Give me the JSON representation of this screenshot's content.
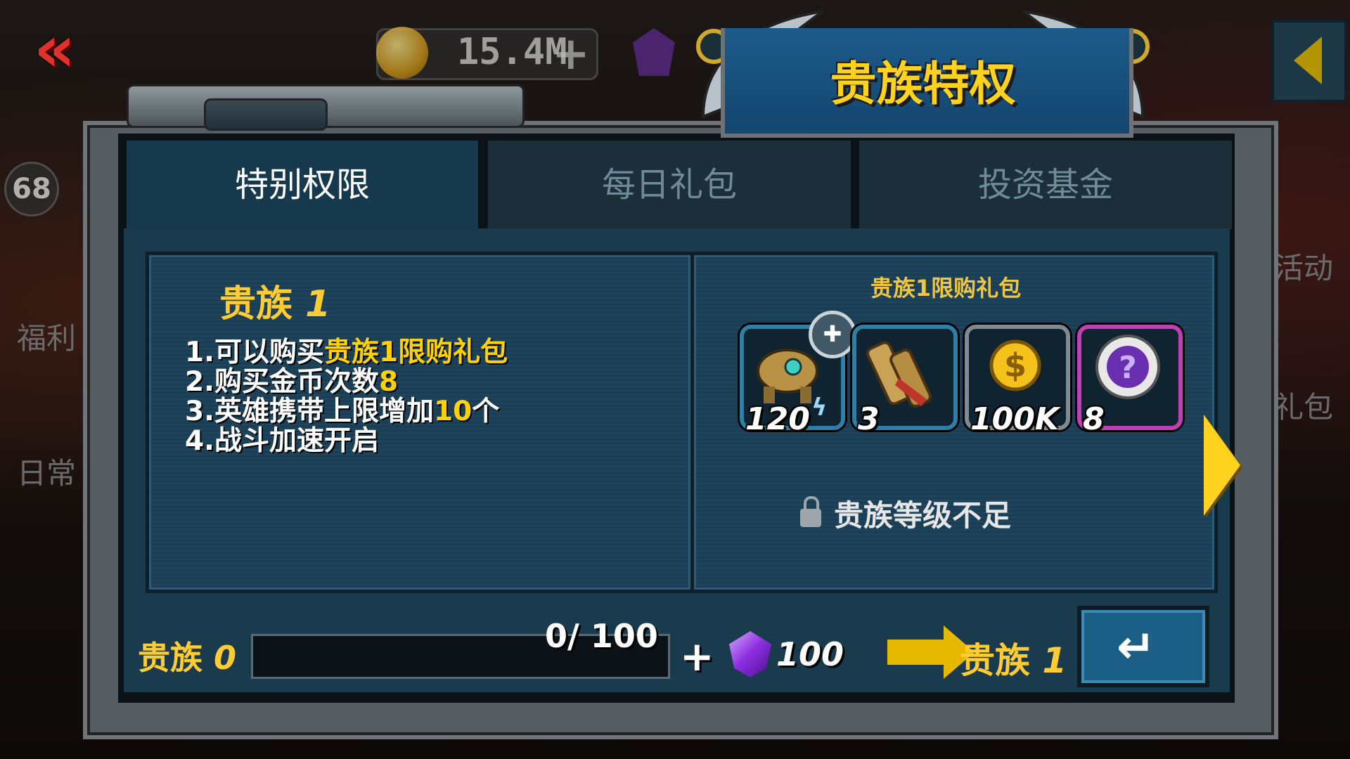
{
  "hud": {
    "coins": "15.4M",
    "coin_plus": "+",
    "level": "68",
    "back_icon": "double-chevron-left-icon",
    "side_labels_left": [
      "福利",
      "日常"
    ],
    "side_labels_right": [
      "活动",
      "礼包"
    ]
  },
  "title": "贵族特权",
  "tabs": [
    {
      "label": "特别权限",
      "active": true
    },
    {
      "label": "每日礼包",
      "active": false
    },
    {
      "label": "投资基金",
      "active": false
    }
  ],
  "privileges": {
    "noble_label": "贵族",
    "noble_level": "1",
    "items": [
      {
        "num": "1.",
        "pre": "可以购买",
        "hl": "贵族1限购礼包",
        "post": ""
      },
      {
        "num": "2.",
        "pre": "购买金币次数",
        "hl": "8",
        "post": ""
      },
      {
        "num": "3.",
        "pre": "英雄携带上限增加",
        "hl": "10",
        "post": "个"
      },
      {
        "num": "4.",
        "pre": "战斗加速开启",
        "hl": "",
        "post": ""
      }
    ]
  },
  "gift": {
    "title": "贵族1限购礼包",
    "items": [
      {
        "name": "robot-hero-shard-icon",
        "qty": "120",
        "border": "#2c80a8",
        "badge": "puzzle-icon"
      },
      {
        "name": "scroll-icon",
        "qty": "3",
        "border": "#2c80a8"
      },
      {
        "name": "gold-coin-icon",
        "qty": "100K",
        "border": "#7f8b92"
      },
      {
        "name": "mystery-chip-icon",
        "qty": "8",
        "border": "#c13fb4"
      }
    ],
    "lock_text": "贵族等级不足"
  },
  "progress": {
    "current_label": "贵族",
    "current_level": "0",
    "value": 0,
    "max": 100,
    "text": "0/ 100",
    "plus": "+",
    "gem_amount": "100",
    "next_label": "贵族",
    "next_level": "1"
  },
  "colors": {
    "accent": "#ffd21e",
    "panel": "#193e55"
  }
}
